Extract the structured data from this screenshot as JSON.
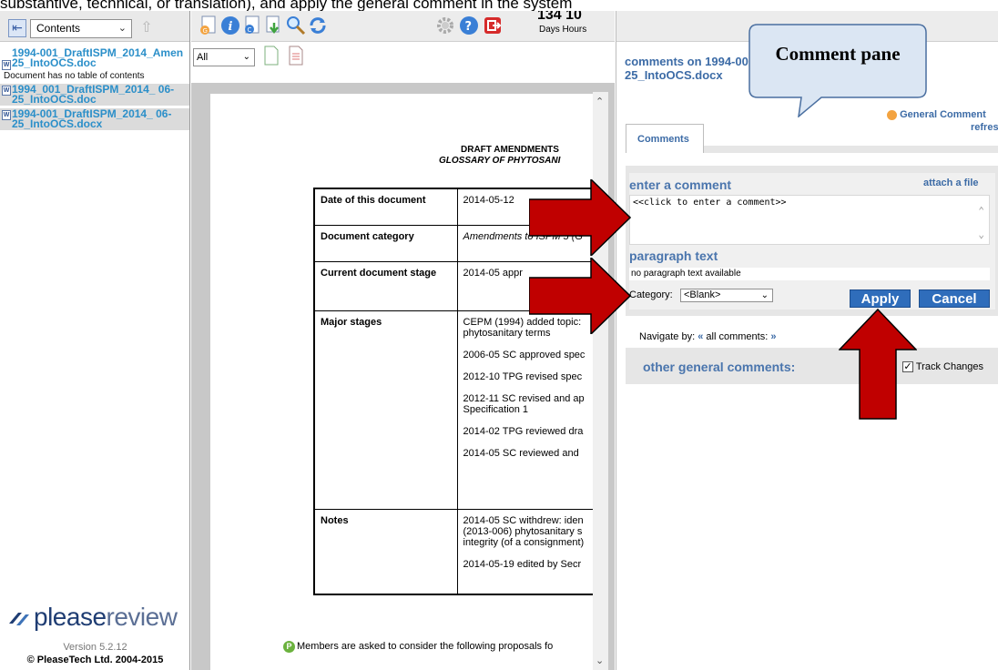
{
  "caption": "substantive, technical, or translation), and apply the general comment in the system",
  "sidebar": {
    "contents_select": "Contents",
    "documents": [
      {
        "label": "1994-001_DraftISPM_2014_Amen 25_IntoOCS.doc",
        "selected": false
      },
      {
        "label": "1994_001_DraftISPM_2014_ 06-25_IntoOCS.doc",
        "selected": true
      },
      {
        "label": "1994-001_DraftISPM_2014_ 06-25_IntoOCS.docx",
        "selected": true
      }
    ],
    "no_toc_note": "Document has no table of contents",
    "logo_prefix": "please",
    "logo_suffix": "review",
    "version": "Version 5.2.12",
    "copyright": "© PleaseTech Ltd. 2004-2015"
  },
  "toolbar": {
    "days_value": "134 10",
    "days_label": "Days Hours",
    "filter_select": "All"
  },
  "document": {
    "title1": "DRAFT AMENDMENTS",
    "title2": "GLOSSARY OF PHYTOSANI",
    "rows": [
      {
        "key": "Date of this document",
        "value": [
          "2014-05-12"
        ],
        "italic": false
      },
      {
        "key": "Document category",
        "value": [
          "Amendments to ISPM 5 (G"
        ],
        "italic": true
      },
      {
        "key": "Current document stage",
        "value": [
          "2014-05 appr"
        ],
        "italic": false
      },
      {
        "key": "Major stages",
        "value": [
          "CEPM (1994) added topic: phytosanitary terms",
          "2006-05 SC approved spec",
          "2012-10 TPG revised spec",
          "2012-11 SC revised and ap Specification 1",
          "2014-02 TPG reviewed dra",
          "2014-05 SC reviewed and"
        ],
        "italic": false
      },
      {
        "key": "Notes",
        "value": [
          "2014-05 SC withdrew: iden (2013-006) phytosanitary s integrity (of a consignment)",
          "2014-05-19 edited by Secr"
        ],
        "italic": false
      }
    ],
    "bottom_note": "Members are asked to consider the following proposals fo"
  },
  "comments": {
    "title": "comments on 1994-001_DraftISPM_2014_En_2014-06-25_IntoOCS.docx",
    "general_comment": "General Comment",
    "refresh": "refres",
    "tab": "Comments",
    "enter_label": "enter a comment",
    "attach_label": "attach a file",
    "placeholder": "<<click to enter a comment>>",
    "paragraph_label": "paragraph text",
    "paragraph_text": "no paragraph text available",
    "category_label": "Category:",
    "category_value": "<Blank>",
    "apply": "Apply",
    "cancel": "Cancel",
    "navigate_label": "Navigate by:",
    "nav_prev": "«",
    "all_comments": "all comments:",
    "nav_next": "»",
    "other_label": "other general comments:",
    "track_changes": "Track Changes",
    "track_checked": true
  },
  "callout": {
    "text": "Comment pane"
  },
  "colors": {
    "accent_blue": "#3c6ba6",
    "button_blue": "#2f6dbb",
    "arrow_red": "#c00000",
    "link_blue": "#2b8fc9"
  }
}
